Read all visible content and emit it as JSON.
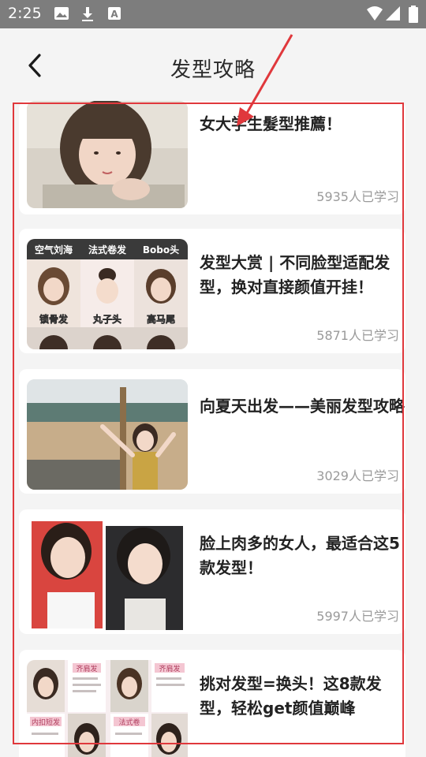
{
  "status_bar": {
    "time": "2:25",
    "left_icons": [
      "image-icon",
      "download-icon",
      "font-icon"
    ],
    "right_icons": [
      "wifi-icon",
      "signal-icon",
      "battery-icon"
    ]
  },
  "header": {
    "title": "发型攻略",
    "back_icon": "chevron-left-icon"
  },
  "articles": [
    {
      "title": "女大学生髮型推薦！",
      "count": "5935人已学习"
    },
    {
      "title": "发型大赏 | 不同脸型适配发型，换对直接颜值开挂！",
      "count": "5871人已学习",
      "image_labels": [
        "空气刘海",
        "法式卷发",
        "Bobo头",
        "锁骨发",
        "丸子头",
        "高马尾"
      ]
    },
    {
      "title": "向夏天出发——美丽发型攻略",
      "count": "3029人已学习"
    },
    {
      "title": "脸上肉多的女人，最适合这5款发型！",
      "count": "5997人已学习"
    },
    {
      "title": "挑对发型=换头！这8款发型，轻松get颜值巅峰",
      "count": "",
      "image_labels": [
        "齐肩发",
        "齐肩发",
        "内扣短发",
        "法式卷"
      ]
    }
  ],
  "annotation": {
    "color": "#e0383c"
  }
}
